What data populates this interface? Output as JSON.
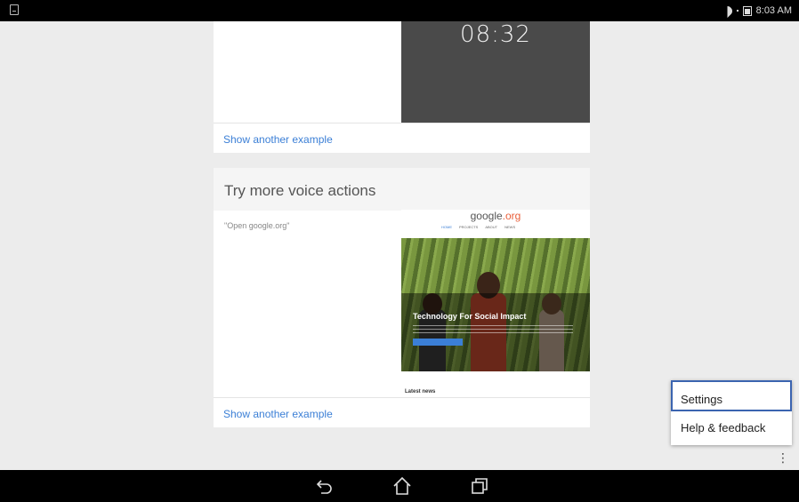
{
  "status_bar": {
    "time": "8:03 AM"
  },
  "top_card": {
    "clock_time": "08:32",
    "link": "Show another example"
  },
  "voice_card": {
    "title": "Try more voice actions",
    "example_command": "\"Open google.org\"",
    "link": "Show another example",
    "preview": {
      "logo_main": "google",
      "logo_suffix": ".org",
      "nav": [
        "HOME",
        "PROJECTS",
        "ABOUT",
        "NEWS"
      ],
      "hero_title": "Technology For Social Impact",
      "footer_heading": "Latest news"
    }
  },
  "menu": {
    "items": [
      {
        "label": "Settings"
      },
      {
        "label": "Help & feedback"
      }
    ]
  },
  "overflow_icon": "more-vert-icon",
  "nav_bar": {
    "icons": [
      "back-icon",
      "home-icon",
      "recents-icon"
    ]
  },
  "colors": {
    "accent": "#3b7fd6",
    "selection_border": "#3b64b0"
  }
}
